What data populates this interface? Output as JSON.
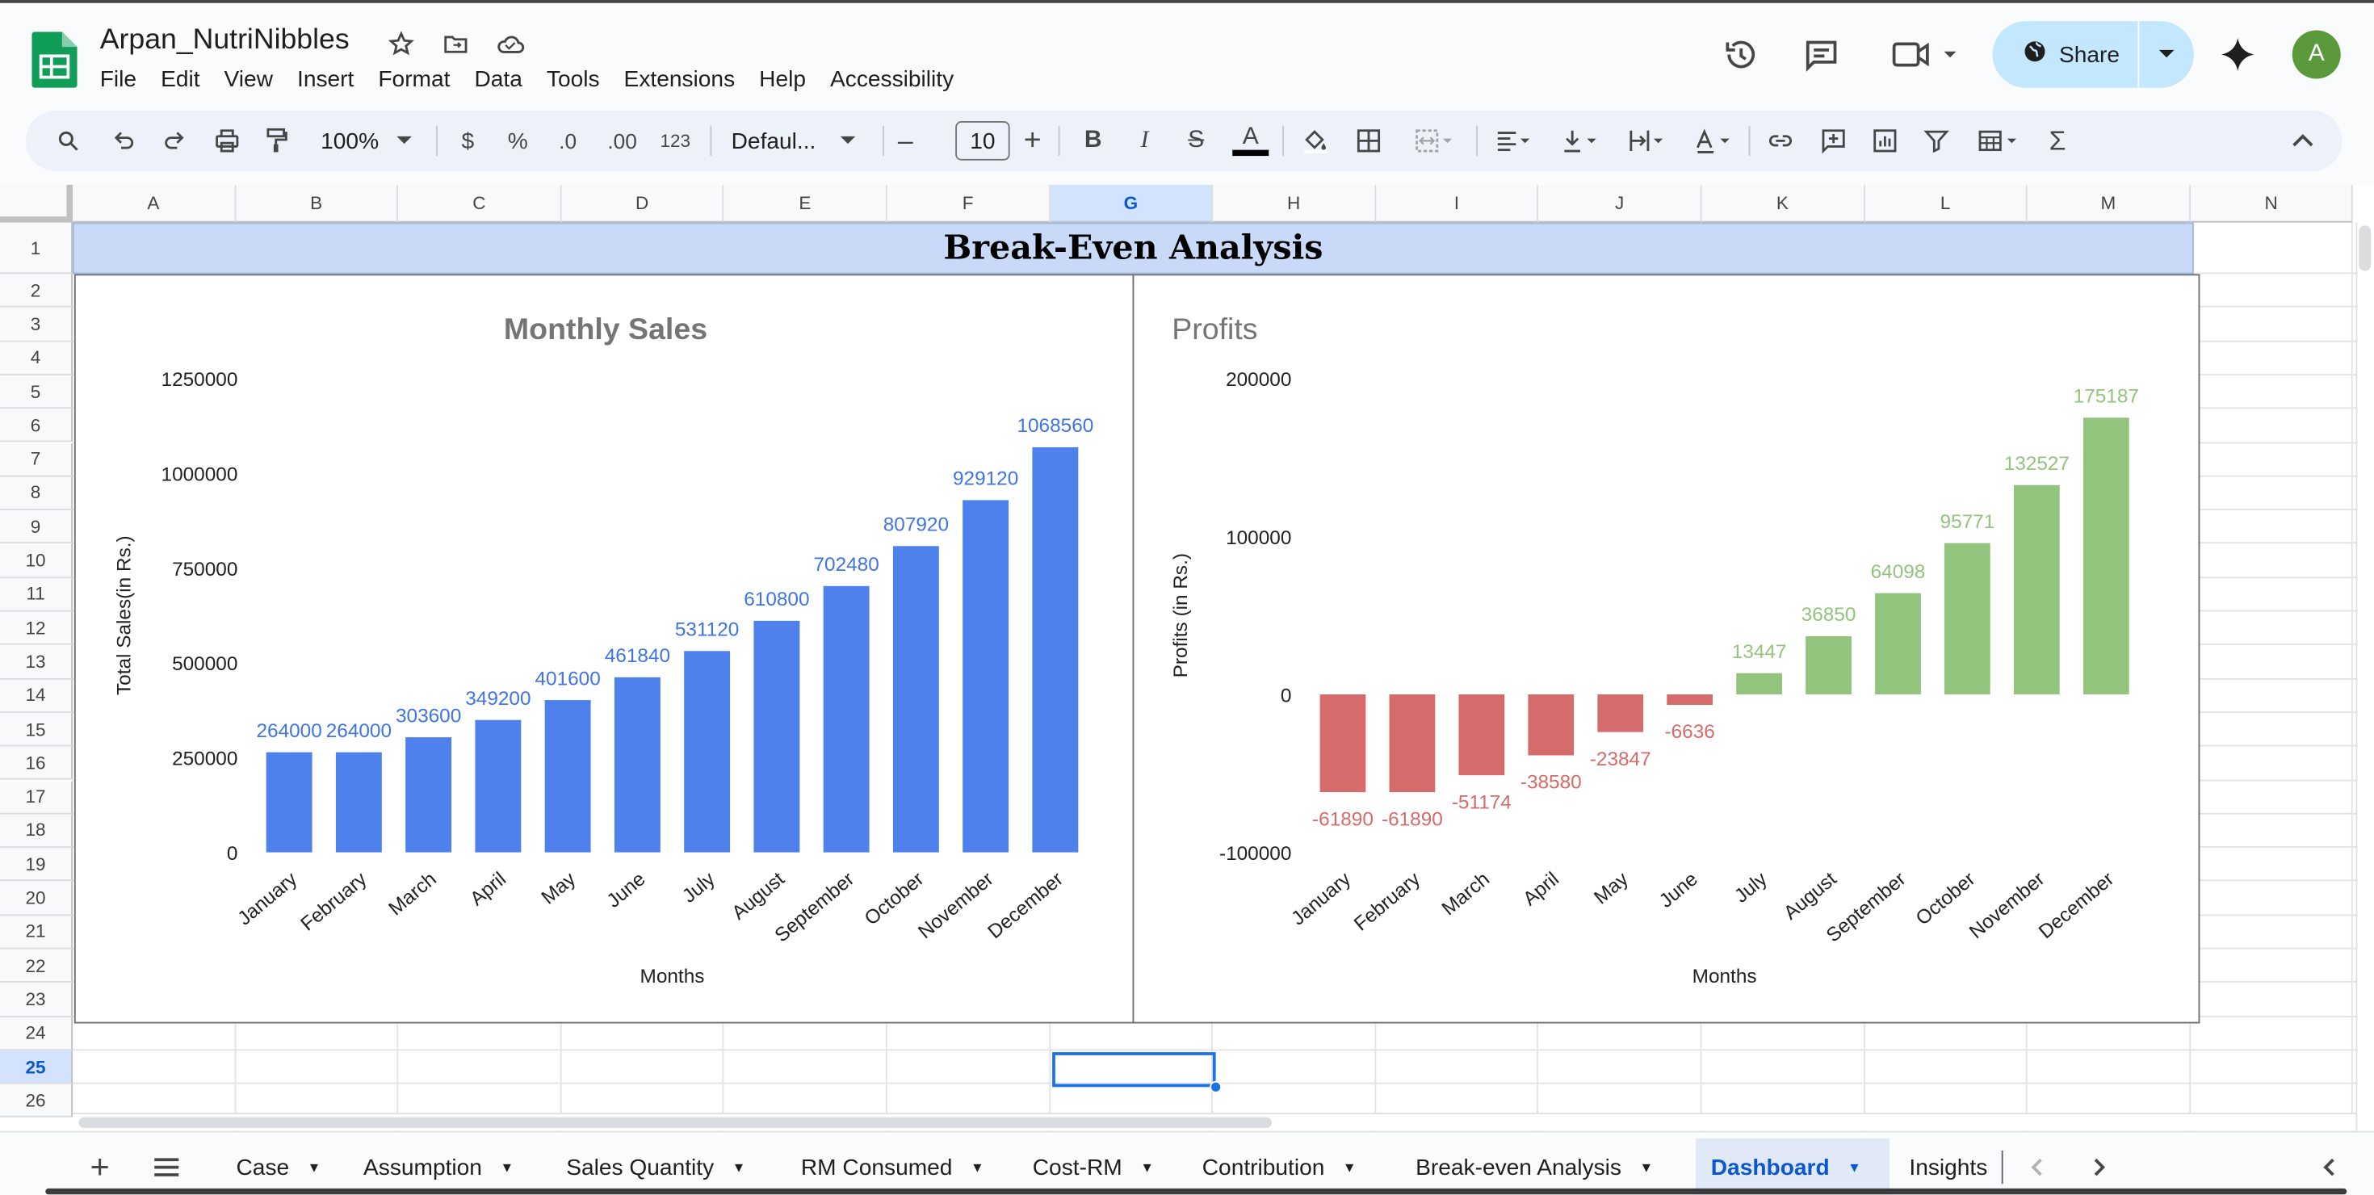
{
  "app": {
    "doc_title": "Arpan_NutriNibbles",
    "menu": [
      "File",
      "Edit",
      "View",
      "Insert",
      "Format",
      "Data",
      "Tools",
      "Extensions",
      "Help",
      "Accessibility"
    ],
    "share_label": "Share",
    "avatar_letter": "A"
  },
  "toolbar": {
    "zoom": "100%",
    "currency": "$",
    "percent": "%",
    "dec_decrease": ".0",
    "dec_increase": ".00",
    "number_format": "123",
    "font": "Defaul...",
    "font_size": "10",
    "bold": "B",
    "italic": "I",
    "strike": "S",
    "text_color": "A",
    "functions": "Σ"
  },
  "grid": {
    "columns": [
      "A",
      "B",
      "C",
      "D",
      "E",
      "F",
      "G",
      "H",
      "I",
      "J",
      "K",
      "L",
      "M",
      "N"
    ],
    "rows": [
      "1",
      "2",
      "3",
      "4",
      "5",
      "6",
      "7",
      "8",
      "9",
      "10",
      "11",
      "12",
      "13",
      "14",
      "15",
      "16",
      "17",
      "18",
      "19",
      "20",
      "21",
      "22",
      "23",
      "24",
      "25",
      "26"
    ],
    "selected_column": "G",
    "selected_row": "25",
    "banner_text": "Break-Even Analysis"
  },
  "chart_data": [
    {
      "type": "bar",
      "title": "Monthly Sales",
      "xlabel": "Months",
      "ylabel": "Total Sales(in Rs.)",
      "categories": [
        "January",
        "February",
        "March",
        "April",
        "May",
        "June",
        "July",
        "August",
        "September",
        "October",
        "November",
        "December"
      ],
      "values": [
        264000,
        264000,
        303600,
        349200,
        401600,
        461840,
        531120,
        610800,
        702480,
        807920,
        929120,
        1068560
      ],
      "yticks": [
        "0",
        "250000",
        "500000",
        "750000",
        "1000000",
        "1250000"
      ],
      "ylim": [
        0,
        1250000
      ],
      "color": "#4f81ed",
      "label_color": "#3f74e6",
      "grid": false
    },
    {
      "type": "bar",
      "title": "Profits",
      "xlabel": "Months",
      "ylabel": "Profits (in Rs.)",
      "categories": [
        "January",
        "February",
        "March",
        "April",
        "May",
        "June",
        "July",
        "August",
        "September",
        "October",
        "November",
        "December"
      ],
      "values": [
        -61890,
        -61890,
        -51174,
        -38580,
        -23847,
        -6636,
        13447,
        36850,
        64098,
        95771,
        132527,
        175187
      ],
      "yticks": [
        "-100000",
        "0",
        "100000",
        "200000"
      ],
      "ylim": [
        -100000,
        200000
      ],
      "positive_color": "#93c47d",
      "negative_color": "#d56b6b",
      "grid": false
    }
  ],
  "sheets": {
    "tabs": [
      "Case",
      "Assumption",
      "Sales Quantity",
      "RM Consumed",
      "Cost-RM",
      "Contribution",
      "Break-even Analysis",
      "Dashboard",
      "Insights"
    ],
    "active": "Dashboard"
  }
}
